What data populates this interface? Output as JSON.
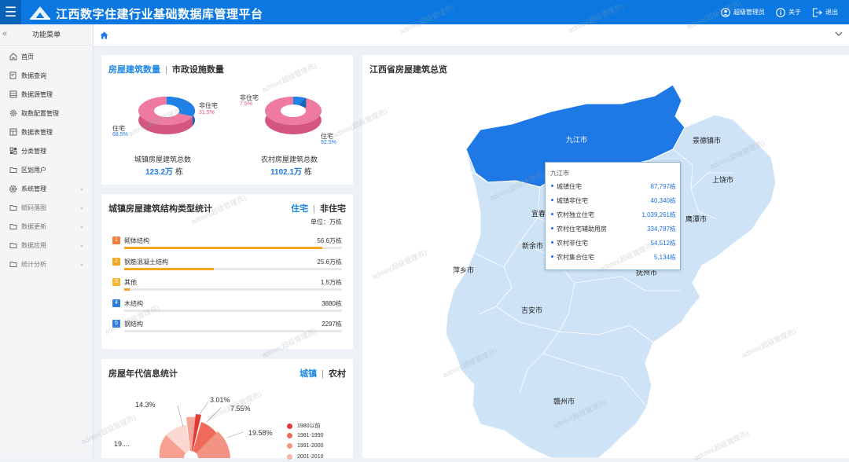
{
  "header": {
    "title": "江西数字住建行业基础数据库管理平台",
    "user": "超级管理员",
    "about": "关于",
    "logout": "退出"
  },
  "sidebar": {
    "title": "功能菜单",
    "items": [
      {
        "label": "首页",
        "icon": "home-icon",
        "chevron": false,
        "muted": false
      },
      {
        "label": "数据查询",
        "icon": "search-doc-icon",
        "chevron": false,
        "muted": false
      },
      {
        "label": "数据源管理",
        "icon": "database-icon",
        "chevron": false,
        "muted": false
      },
      {
        "label": "取数配置管理",
        "icon": "gear-icon",
        "chevron": false,
        "muted": false
      },
      {
        "label": "数据表管理",
        "icon": "table-icon",
        "chevron": false,
        "muted": false
      },
      {
        "label": "分类管理",
        "icon": "grid-icon",
        "chevron": false,
        "muted": false
      },
      {
        "label": "区划用户",
        "icon": "folder-icon",
        "chevron": false,
        "muted": false
      },
      {
        "label": "系统管理",
        "icon": "settings-icon",
        "chevron": true,
        "muted": false
      },
      {
        "label": "赋码落图",
        "icon": "folder-icon",
        "chevron": true,
        "muted": true
      },
      {
        "label": "数据更新",
        "icon": "folder-icon",
        "chevron": true,
        "muted": true
      },
      {
        "label": "数据应用",
        "icon": "folder-icon",
        "chevron": true,
        "muted": true
      },
      {
        "label": "统计分析",
        "icon": "folder-icon",
        "chevron": true,
        "muted": true
      }
    ]
  },
  "panel1": {
    "tab_active": "房屋建筑数量",
    "tab_inactive": "市政设施数量",
    "urban": {
      "nonres_label": "非住宅",
      "nonres_pct": "31.5%",
      "res_label": "住宅",
      "res_pct": "68.5%",
      "caption": "城镇房屋建筑总数",
      "total": "123.2万",
      "unit": "栋"
    },
    "rural": {
      "nonres_label": "非住宅",
      "nonres_pct": "7.5%",
      "res_label": "住宅",
      "res_pct": "92.5%",
      "caption": "农村房屋建筑总数",
      "total": "1102.1万",
      "unit": "栋"
    }
  },
  "panel2": {
    "title": "城镇房屋建筑结构类型统计",
    "tab_active": "住宅",
    "tab_inactive": "非住宅",
    "unit": "单位：万栋",
    "rows": [
      {
        "rank": "1",
        "label": "砌体结构",
        "value": "56.6万栋",
        "ratio": 0.91,
        "color": "#f57c38",
        "bar": "#f5a623"
      },
      {
        "rank": "2",
        "label": "钢筋混凝土结构",
        "value": "25.6万栋",
        "ratio": 0.41,
        "color": "#f5a623",
        "bar": "#f5a623"
      },
      {
        "rank": "3",
        "label": "其他",
        "value": "1.5万栋",
        "ratio": 0.025,
        "color": "#f7b731",
        "bar": "#f5a623"
      },
      {
        "rank": "4",
        "label": "木结构",
        "value": "3880栋",
        "ratio": 0,
        "color": "#2f7de1",
        "bar": "#2f7de1"
      },
      {
        "rank": "5",
        "label": "钢结构",
        "value": "2297栋",
        "ratio": 0,
        "color": "#2f7de1",
        "bar": "#2f7de1"
      }
    ]
  },
  "panel3": {
    "title": "房屋年代信息统计",
    "tab_active": "城镇",
    "tab_inactive": "农村",
    "labels": [
      "14.3%",
      "3.01%",
      "7.55%",
      "19.58%",
      "19...."
    ],
    "legend": [
      "1980以前",
      "1981-1990",
      "1991-2000",
      "2001-2010"
    ],
    "legend_colors": [
      "#e53935",
      "#ef6a5a",
      "#f39384",
      "#f6b4a8"
    ]
  },
  "map": {
    "title": "江西省房屋建筑总览",
    "cities": [
      "九江市",
      "景德镇市",
      "上饶市",
      "宜春",
      "鹰潭市",
      "新余市",
      "抚州市",
      "萍乡市",
      "吉安市",
      "赣州市"
    ],
    "highlight_color": "#1e78e6",
    "base_color": "#cfe3f7",
    "tooltip": {
      "title": "九江市",
      "rows": [
        {
          "k": "城镇住宅",
          "v": "87,797栋"
        },
        {
          "k": "城镇非住宅",
          "v": "40,340栋"
        },
        {
          "k": "农村独立住宅",
          "v": "1,039,261栋"
        },
        {
          "k": "农村住宅辅助用房",
          "v": "334,787栋"
        },
        {
          "k": "农村非住宅",
          "v": "54,512栋"
        },
        {
          "k": "农村集合住宅",
          "v": "5,134栋"
        }
      ]
    }
  },
  "watermark": "admin(超级管理员)"
}
